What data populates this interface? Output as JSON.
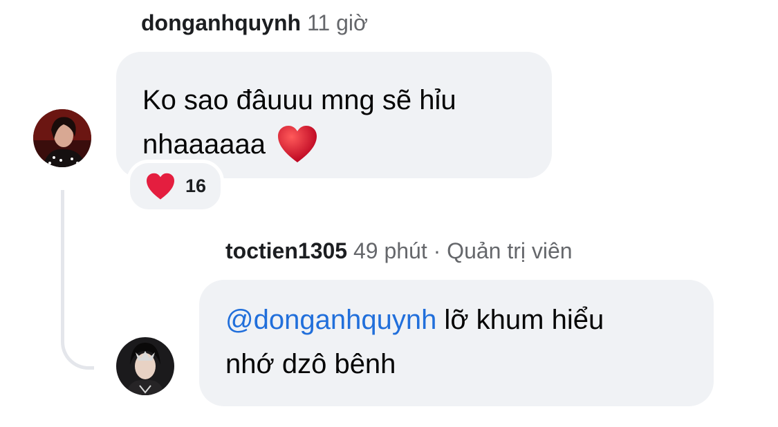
{
  "comments": [
    {
      "username": "donganhquynh",
      "time": "11 giờ",
      "text_line1": "Ko sao đâuuu mng sẽ hỉu",
      "text_line2": "nhaaaaaa",
      "emoji": "heart-icon",
      "reaction": {
        "icon": "heart-icon",
        "count": "16"
      }
    },
    {
      "username": "toctien1305",
      "time": "49 phút",
      "separator": "·",
      "role": "Quản trị viên",
      "mention": "@donganhquynh",
      "text_line1_rest": " lỡ khum hiểu",
      "text_line2": "nhớ dzô bênh"
    }
  ],
  "colors": {
    "bubble": "#f0f2f5",
    "mention": "#216fdb",
    "meta": "#65676b",
    "heart": "#e41e3f"
  }
}
